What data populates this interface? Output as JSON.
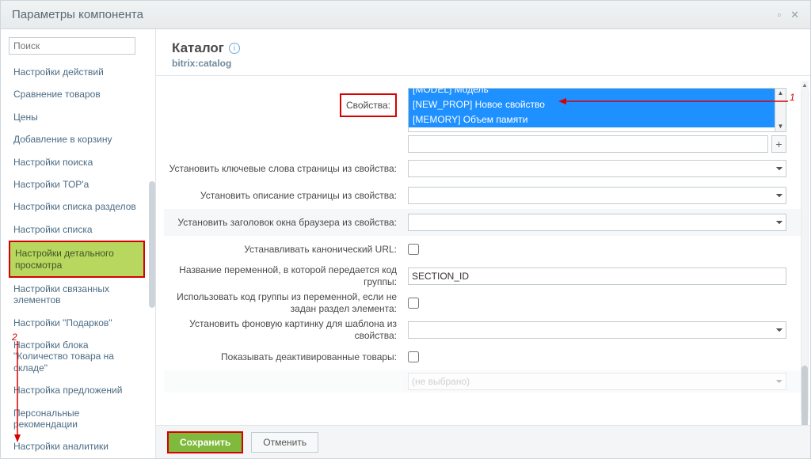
{
  "window": {
    "title": "Параметры компонента",
    "min_icon": "▫",
    "close_icon": "✕"
  },
  "sidebar": {
    "search_placeholder": "Поиск",
    "items": [
      {
        "label": "Настройки действий"
      },
      {
        "label": "Сравнение товаров"
      },
      {
        "label": "Цены"
      },
      {
        "label": "Добавление в корзину"
      },
      {
        "label": "Настройки поиска"
      },
      {
        "label": "Настройки ТОР'а"
      },
      {
        "label": "Настройки списка разделов"
      },
      {
        "label": "Настройки списка"
      },
      {
        "label": "Настройки детального просмотра",
        "active": true
      },
      {
        "label": "Настройки связанных элементов"
      },
      {
        "label": "Настройки \"Подарков\""
      },
      {
        "label": "Настройки блока \"Количество товара на складе\""
      },
      {
        "label": "Настройка предложений"
      },
      {
        "label": "Персональные рекомендации"
      },
      {
        "label": "Настройки аналитики"
      }
    ]
  },
  "header": {
    "title": "Каталог",
    "sub": "bitrix:catalog"
  },
  "props": {
    "label": "Свойства:",
    "options": [
      "[MODEL] Модель",
      "[NEW_PROP] Новое свойство",
      "[MEMORY] Объем памяти"
    ],
    "add": "+"
  },
  "rows": {
    "keywords": "Установить ключевые слова страницы из свойства:",
    "descr": "Установить описание страницы из свойства:",
    "browser_title": "Установить заголовок окна браузера из свойства:",
    "canonical": "Устанавливать канонический URL:",
    "var_name": "Название переменной, в которой передается код группы:",
    "var_value": "SECTION_ID",
    "use_group": "Использовать код группы из переменной, если не задан раздел элемента:",
    "bg": "Установить фоновую картинку для шаблона из свойства:",
    "deact": "Показывать деактивированные товары:",
    "last": "(не выбрано)"
  },
  "footer": {
    "save": "Сохранить",
    "cancel": "Отменить"
  },
  "annotations": {
    "n1": "1",
    "n2": "2"
  },
  "colors": {
    "highlight": "#d80000",
    "accent": "#1e90ff",
    "green": "#7fba3d",
    "active": "#b8d75f"
  }
}
